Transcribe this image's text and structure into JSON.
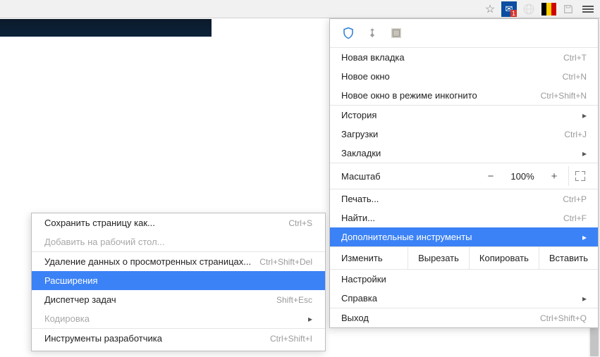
{
  "toolbar": {
    "mail_badge": "1"
  },
  "main_menu": {
    "new_tab": "Новая вкладка",
    "new_tab_sc": "Ctrl+T",
    "new_window": "Новое окно",
    "new_window_sc": "Ctrl+N",
    "incognito": "Новое окно в режиме инкогнито",
    "incognito_sc": "Ctrl+Shift+N",
    "history": "История",
    "downloads": "Загрузки",
    "downloads_sc": "Ctrl+J",
    "bookmarks": "Закладки",
    "zoom_label": "Масштаб",
    "zoom_minus": "−",
    "zoom_value": "100%",
    "zoom_plus": "+",
    "print": "Печать...",
    "print_sc": "Ctrl+P",
    "find": "Найти...",
    "find_sc": "Ctrl+F",
    "more_tools": "Дополнительные инструменты",
    "edit_label": "Изменить",
    "cut": "Вырезать",
    "copy": "Копировать",
    "paste": "Вставить",
    "settings": "Настройки",
    "help": "Справка",
    "exit": "Выход",
    "exit_sc": "Ctrl+Shift+Q"
  },
  "sub_menu": {
    "save_page": "Сохранить страницу как...",
    "save_page_sc": "Ctrl+S",
    "add_to_desktop": "Добавить на рабочий стол...",
    "clear_data": "Удаление данных о просмотренных страницах...",
    "clear_data_sc": "Ctrl+Shift+Del",
    "extensions": "Расширения",
    "task_manager": "Диспетчер задач",
    "task_manager_sc": "Shift+Esc",
    "encoding": "Кодировка",
    "devtools": "Инструменты разработчика",
    "devtools_sc": "Ctrl+Shift+I"
  }
}
